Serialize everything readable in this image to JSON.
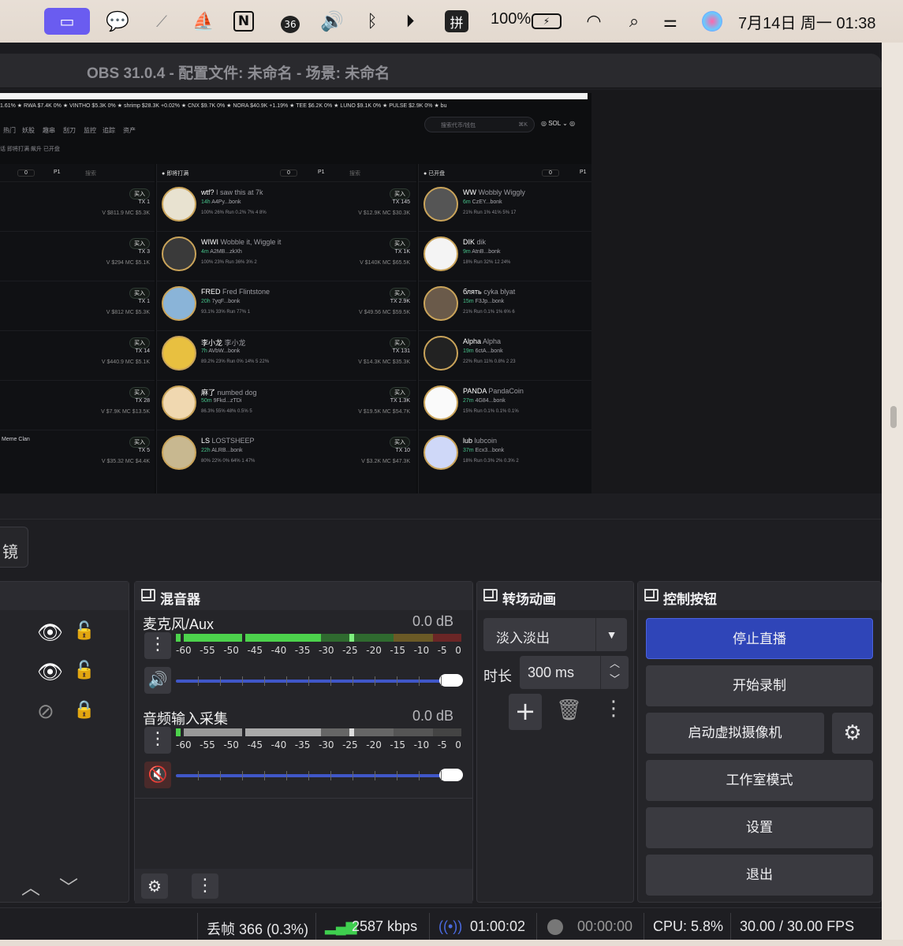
{
  "menubar": {
    "battery": "100%",
    "badge_36": "36",
    "clock": "7月14日 周一  01:38",
    "input_method": "拼",
    "icons": [
      "screen-share-icon",
      "wechat-icon",
      "signal-icon",
      "app-icon",
      "notion-icon",
      "badge-app-icon",
      "volume-icon",
      "bluetooth-icon",
      "play-icon",
      "input-method-icon",
      "battery-icon",
      "wifi-icon",
      "search-icon",
      "control-center-icon",
      "siri-icon"
    ]
  },
  "window": {
    "title": "OBS 31.0.4 - 配置文件: 未命名 - 场景: 未命名"
  },
  "preview": {
    "ticker": "1.61% ★  RWA $7.4K 0% ★    VINTHO $5.3K 0% ★    shrimp $28.3K +0.02% ★    CNX $9.7K 0% ★    NORA $40.9K +1.19% ★    TEE $6.2K 0% ★    LUNO $9.1K 0% ★    PULSE $2.9K 0% ★   bu",
    "nav": [
      "热门",
      "妖股",
      "趣串",
      "刮刀",
      "监控",
      "追踪",
      "资产"
    ],
    "search_placeholder": "搜索代币/钱包",
    "search_shortcut": "⌘K",
    "chain": "SOL",
    "subnav": "话   即将打满   飙升   已开盘",
    "col2_title": "即将打满",
    "col3_title": "已开盘",
    "col_filter": "P1",
    "col_search": "搜索",
    "col_count": "0",
    "buy_label": "买入",
    "left_rows": [
      {
        "v": "$811.9",
        "mc": "$5.3K",
        "tx": "TX 1"
      },
      {
        "v": "$294",
        "mc": "$5.1K",
        "tx": "TX 3"
      },
      {
        "v": "$812",
        "mc": "$5.3K",
        "tx": "TX 1"
      },
      {
        "v": "$440.9",
        "mc": "$5.1K",
        "tx": "TX 14"
      },
      {
        "v": "$7.9K",
        "mc": "$13.5K",
        "tx": "TX 28"
      },
      {
        "v": "$35.32",
        "mc": "$4.4K",
        "tx": "TX 5",
        "name": "Meme Clan"
      }
    ],
    "mid_cards": [
      {
        "sym": "wtf?",
        "name": "I saw this at 7k",
        "age": "14h",
        "addr": "A4Py...bonk",
        "v": "$12.9K",
        "mc": "$30.3K",
        "tx": "TX 145",
        "stats": "100%  26%  Run  0.2%  7%  4  8%"
      },
      {
        "sym": "WIWI",
        "name": "Wobble it, Wiggle it",
        "age": "4m",
        "addr": "A2MB...zkXh",
        "v": "$140K",
        "mc": "$65.5K",
        "tx": "TX 1K",
        "stats": "100%  23%  Run  36%  3%  2"
      },
      {
        "sym": "FRED",
        "name": "Fred Flintstone",
        "age": "20h",
        "addr": "7yqF...bonk",
        "v": "$49.56",
        "mc": "$59.5K",
        "tx": "TX 2.9K",
        "stats": "93.1%  33%  Run  77%  1"
      },
      {
        "sym": "李小龙",
        "name": "李小龙",
        "age": "7h",
        "addr": "AVbW...bonk",
        "v": "$14.3K",
        "mc": "$35.3K",
        "tx": "TX 131",
        "stats": "89.2%  23%  Run  0%  14%  5  22%"
      },
      {
        "sym": "麻了",
        "name": "numbed dog",
        "age": "50m",
        "addr": "9Fkd...zTDi",
        "v": "$19.5K",
        "mc": "$54.7K",
        "tx": "TX 1.3K",
        "stats": "86.3%  55%  48%  0.5%  5"
      },
      {
        "sym": "LS",
        "name": "LOSTSHEEP",
        "age": "22h",
        "addr": "ALRB...bonk",
        "v": "$3.2K",
        "mc": "$47.3K",
        "tx": "TX 10",
        "stats": "80%  22%  0%  64%  1  47%"
      }
    ],
    "right_cards": [
      {
        "sym": "WW",
        "name": "Wobbly Wiggly",
        "age": "6m",
        "addr": "CzEY...bonk",
        "stats": "21%  Run  1%  41%  5%  17"
      },
      {
        "sym": "DIK",
        "name": "dik",
        "age": "9m",
        "addr": "AtnB...bonk",
        "stats": "18%  Run  32%  12  24%"
      },
      {
        "sym": "блять",
        "name": "cyka blyat",
        "age": "15m",
        "addr": "F3Jp...bonk",
        "stats": "21%  Run  0.1%  1%  6%  6"
      },
      {
        "sym": "Alpha",
        "name": "Alpha",
        "age": "19m",
        "addr": "6ctA...bonk",
        "stats": "22%  Run  11%  0.8%  2  23"
      },
      {
        "sym": "PANDA",
        "name": "PandaCoin",
        "age": "27m",
        "addr": "4G84...bonk",
        "stats": "15%  Run  0.1%  0.1%  0.1%"
      },
      {
        "sym": "lub",
        "name": "lubcoin",
        "age": "37m",
        "addr": "Ecx3...bonk",
        "stats": "18%  Run  0.3%  2%  0.3%  2"
      }
    ]
  },
  "filter_button": "镜",
  "mixer": {
    "title": "混音器",
    "channels": [
      {
        "name": "麦克风/Aux",
        "db": "0.0 dB",
        "muted": false
      },
      {
        "name": "音频输入采集",
        "db": "0.0 dB",
        "muted": true
      }
    ],
    "ticks": [
      "-60",
      "-55",
      "-50",
      "-45",
      "-40",
      "-35",
      "-30",
      "-25",
      "-20",
      "-15",
      "-10",
      "-5",
      "0"
    ],
    "volume_level": 1.0
  },
  "transitions": {
    "title": "转场动画",
    "selected": "淡入淡出",
    "duration_label": "时长",
    "duration_value": "300 ms"
  },
  "controls": {
    "title": "控制按钮",
    "buttons": [
      "停止直播",
      "开始录制",
      "启动虚拟摄像机",
      "工作室模式",
      "设置",
      "退出"
    ],
    "accent": "#2f45b8"
  },
  "status": {
    "dropped": "丢帧 366 (0.3%)",
    "kbps": "2587 kbps",
    "stream_time": "01:00:02",
    "rec_time": "00:00:00",
    "cpu": "CPU: 5.8%",
    "fps": "30.00 / 30.00 FPS"
  }
}
